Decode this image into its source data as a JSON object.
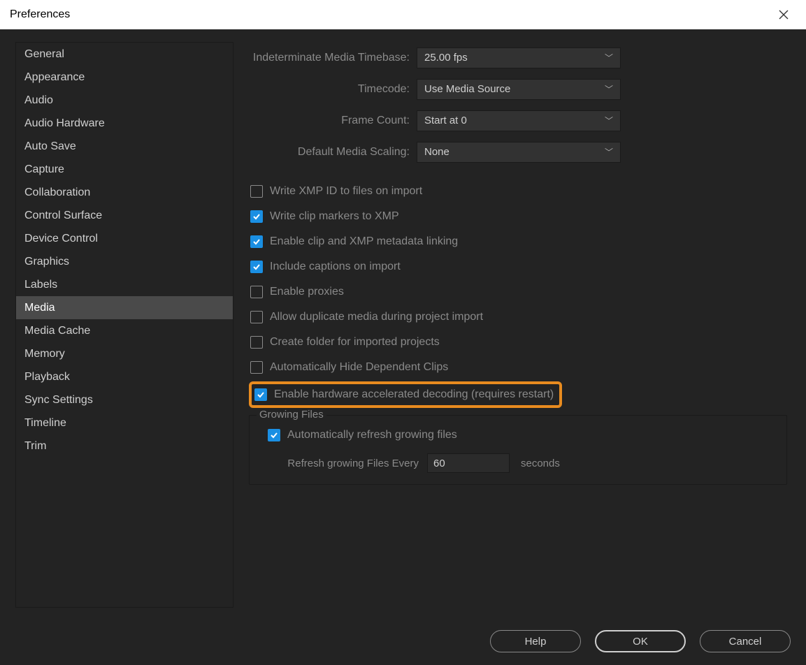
{
  "window": {
    "title": "Preferences"
  },
  "sidebar": {
    "items": [
      {
        "label": "General"
      },
      {
        "label": "Appearance"
      },
      {
        "label": "Audio"
      },
      {
        "label": "Audio Hardware"
      },
      {
        "label": "Auto Save"
      },
      {
        "label": "Capture"
      },
      {
        "label": "Collaboration"
      },
      {
        "label": "Control Surface"
      },
      {
        "label": "Device Control"
      },
      {
        "label": "Graphics"
      },
      {
        "label": "Labels"
      },
      {
        "label": "Media",
        "selected": true
      },
      {
        "label": "Media Cache"
      },
      {
        "label": "Memory"
      },
      {
        "label": "Playback"
      },
      {
        "label": "Sync Settings"
      },
      {
        "label": "Timeline"
      },
      {
        "label": "Trim"
      }
    ]
  },
  "dropdowns": {
    "timebase": {
      "label": "Indeterminate Media Timebase:",
      "value": "25.00 fps"
    },
    "timecode": {
      "label": "Timecode:",
      "value": "Use Media Source"
    },
    "framecount": {
      "label": "Frame Count:",
      "value": "Start at 0"
    },
    "scaling": {
      "label": "Default Media Scaling:",
      "value": "None"
    }
  },
  "checks": {
    "xmp_id": {
      "label": "Write XMP ID to files on import",
      "checked": false
    },
    "clip_markers": {
      "label": "Write clip markers to XMP",
      "checked": true
    },
    "link_meta": {
      "label": "Enable clip and XMP metadata linking",
      "checked": true
    },
    "captions": {
      "label": "Include captions on import",
      "checked": true
    },
    "proxies": {
      "label": "Enable proxies",
      "checked": false
    },
    "dup_media": {
      "label": "Allow duplicate media during project import",
      "checked": false
    },
    "create_folder": {
      "label": "Create folder for imported projects",
      "checked": false
    },
    "hide_dep": {
      "label": "Automatically Hide Dependent Clips",
      "checked": false
    },
    "hw_decode": {
      "label": "Enable hardware accelerated decoding (requires restart)",
      "checked": true
    }
  },
  "growing": {
    "title": "Growing Files",
    "auto_refresh": {
      "label": "Automatically refresh growing files",
      "checked": true
    },
    "refresh_label": "Refresh growing Files Every",
    "refresh_value": "60",
    "refresh_unit": "seconds"
  },
  "buttons": {
    "help": "Help",
    "ok": "OK",
    "cancel": "Cancel"
  }
}
